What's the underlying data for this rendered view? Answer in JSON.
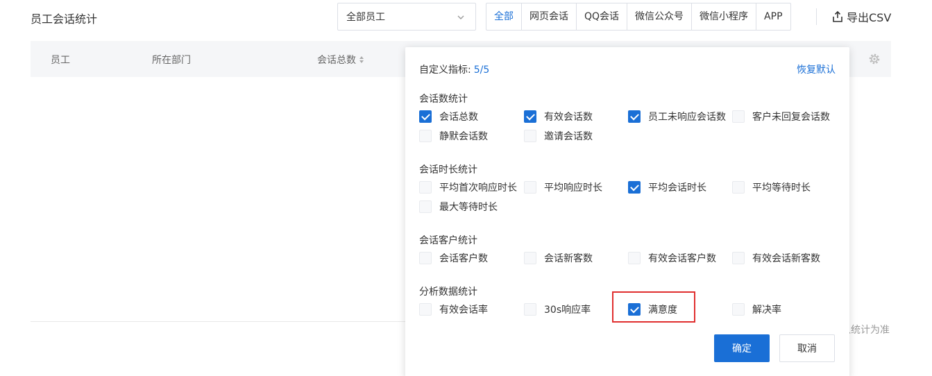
{
  "header": {
    "title": "员工会话统计",
    "employee_select": "全部员工",
    "channels": [
      "全部",
      "网页会话",
      "QQ会话",
      "微信公众号",
      "微信小程序",
      "APP"
    ],
    "active_channel": "全部",
    "export_label": "导出CSV"
  },
  "table": {
    "columns": [
      "员工",
      "所在部门",
      "会话总数"
    ],
    "footnote": "以统计为准"
  },
  "panel": {
    "label": "自定义指标:",
    "count": "5/5",
    "restore_label": "恢复默认",
    "groups": [
      {
        "title": "会话数统计",
        "options": [
          {
            "label": "会话总数",
            "checked": true
          },
          {
            "label": "有效会话数",
            "checked": true
          },
          {
            "label": "员工未响应会话数",
            "checked": true
          },
          {
            "label": "客户未回复会话数",
            "checked": false
          },
          {
            "label": "静默会话数",
            "checked": false
          },
          {
            "label": "邀请会话数",
            "checked": false
          }
        ]
      },
      {
        "title": "会话时长统计",
        "options": [
          {
            "label": "平均首次响应时长",
            "checked": false
          },
          {
            "label": "平均响应时长",
            "checked": false
          },
          {
            "label": "平均会话时长",
            "checked": true
          },
          {
            "label": "平均等待时长",
            "checked": false
          },
          {
            "label": "最大等待时长",
            "checked": false
          }
        ]
      },
      {
        "title": "会话客户统计",
        "options": [
          {
            "label": "会话客户数",
            "checked": false
          },
          {
            "label": "会话新客数",
            "checked": false
          },
          {
            "label": "有效会话客户数",
            "checked": false
          },
          {
            "label": "有效会话新客数",
            "checked": false
          }
        ]
      },
      {
        "title": "分析数据统计",
        "options": [
          {
            "label": "有效会话率",
            "checked": false
          },
          {
            "label": "30s响应率",
            "checked": false
          },
          {
            "label": "满意度",
            "checked": true
          },
          {
            "label": "解决率",
            "checked": false
          }
        ]
      }
    ],
    "ok_label": "确定",
    "cancel_label": "取消"
  },
  "colors": {
    "accent": "#1a6fd6",
    "highlight": "#e02e2e"
  }
}
